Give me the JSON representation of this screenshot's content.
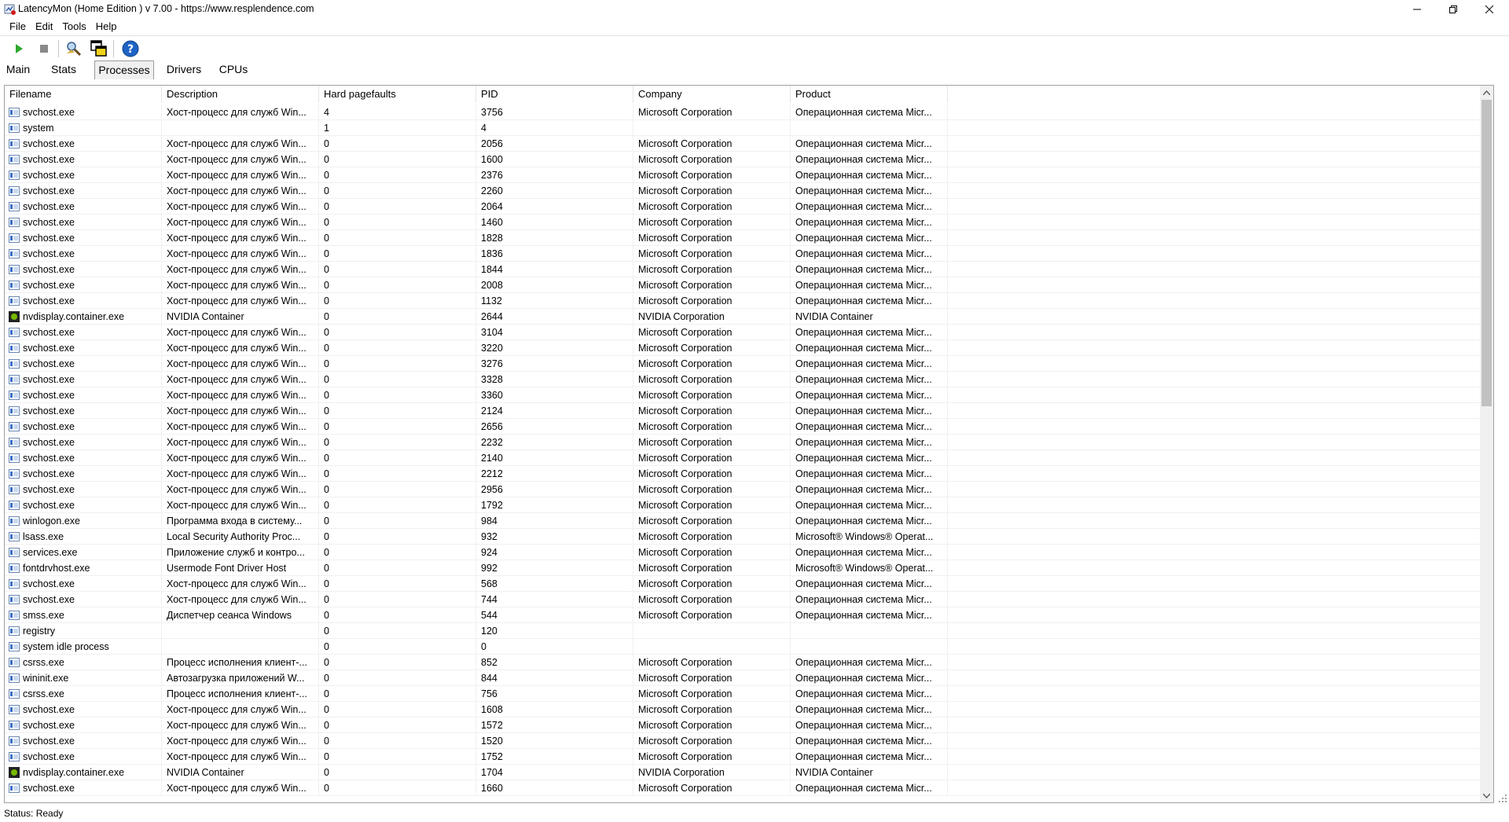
{
  "window": {
    "title": "LatencyMon  (Home Edition )  v 7.00 - https://www.resplendence.com",
    "icon": "latencymon-app-icon"
  },
  "menu": [
    "File",
    "Edit",
    "Tools",
    "Help"
  ],
  "toolbar": {
    "icons": [
      "play-icon",
      "stop-icon",
      "search-icon",
      "windows-icon",
      "help-icon"
    ]
  },
  "tabs": [
    {
      "label": "Main",
      "active": false
    },
    {
      "label": "Stats",
      "active": false
    },
    {
      "label": "Processes",
      "active": true
    },
    {
      "label": "Drivers",
      "active": false
    },
    {
      "label": "CPUs",
      "active": false
    }
  ],
  "table": {
    "columns": [
      "Filename",
      "Description",
      "Hard pagefaults",
      "PID",
      "Company",
      "Product"
    ],
    "rows": [
      {
        "icon": "process",
        "filename": "svchost.exe",
        "description": "Хост-процесс для служб Win...",
        "hard": "4",
        "pid": "3756",
        "company": "Microsoft Corporation",
        "product": "Операционная система Micr..."
      },
      {
        "icon": "process",
        "filename": "system",
        "description": "",
        "hard": "1",
        "pid": "4",
        "company": "",
        "product": ""
      },
      {
        "icon": "process",
        "filename": "svchost.exe",
        "description": "Хост-процесс для служб Win...",
        "hard": "0",
        "pid": "2056",
        "company": "Microsoft Corporation",
        "product": "Операционная система Micr..."
      },
      {
        "icon": "process",
        "filename": "svchost.exe",
        "description": "Хост-процесс для служб Win...",
        "hard": "0",
        "pid": "1600",
        "company": "Microsoft Corporation",
        "product": "Операционная система Micr..."
      },
      {
        "icon": "process",
        "filename": "svchost.exe",
        "description": "Хост-процесс для служб Win...",
        "hard": "0",
        "pid": "2376",
        "company": "Microsoft Corporation",
        "product": "Операционная система Micr..."
      },
      {
        "icon": "process",
        "filename": "svchost.exe",
        "description": "Хост-процесс для служб Win...",
        "hard": "0",
        "pid": "2260",
        "company": "Microsoft Corporation",
        "product": "Операционная система Micr..."
      },
      {
        "icon": "process",
        "filename": "svchost.exe",
        "description": "Хост-процесс для служб Win...",
        "hard": "0",
        "pid": "2064",
        "company": "Microsoft Corporation",
        "product": "Операционная система Micr..."
      },
      {
        "icon": "process",
        "filename": "svchost.exe",
        "description": "Хост-процесс для служб Win...",
        "hard": "0",
        "pid": "1460",
        "company": "Microsoft Corporation",
        "product": "Операционная система Micr..."
      },
      {
        "icon": "process",
        "filename": "svchost.exe",
        "description": "Хост-процесс для служб Win...",
        "hard": "0",
        "pid": "1828",
        "company": "Microsoft Corporation",
        "product": "Операционная система Micr..."
      },
      {
        "icon": "process",
        "filename": "svchost.exe",
        "description": "Хост-процесс для служб Win...",
        "hard": "0",
        "pid": "1836",
        "company": "Microsoft Corporation",
        "product": "Операционная система Micr..."
      },
      {
        "icon": "process",
        "filename": "svchost.exe",
        "description": "Хост-процесс для служб Win...",
        "hard": "0",
        "pid": "1844",
        "company": "Microsoft Corporation",
        "product": "Операционная система Micr..."
      },
      {
        "icon": "process",
        "filename": "svchost.exe",
        "description": "Хост-процесс для служб Win...",
        "hard": "0",
        "pid": "2008",
        "company": "Microsoft Corporation",
        "product": "Операционная система Micr..."
      },
      {
        "icon": "process",
        "filename": "svchost.exe",
        "description": "Хост-процесс для служб Win...",
        "hard": "0",
        "pid": "1132",
        "company": "Microsoft Corporation",
        "product": "Операционная система Micr..."
      },
      {
        "icon": "nvidia",
        "filename": "nvdisplay.container.exe",
        "description": "NVIDIA Container",
        "hard": "0",
        "pid": "2644",
        "company": "NVIDIA Corporation",
        "product": "NVIDIA Container"
      },
      {
        "icon": "process",
        "filename": "svchost.exe",
        "description": "Хост-процесс для служб Win...",
        "hard": "0",
        "pid": "3104",
        "company": "Microsoft Corporation",
        "product": "Операционная система Micr..."
      },
      {
        "icon": "process",
        "filename": "svchost.exe",
        "description": "Хост-процесс для служб Win...",
        "hard": "0",
        "pid": "3220",
        "company": "Microsoft Corporation",
        "product": "Операционная система Micr..."
      },
      {
        "icon": "process",
        "filename": "svchost.exe",
        "description": "Хост-процесс для служб Win...",
        "hard": "0",
        "pid": "3276",
        "company": "Microsoft Corporation",
        "product": "Операционная система Micr..."
      },
      {
        "icon": "process",
        "filename": "svchost.exe",
        "description": "Хост-процесс для служб Win...",
        "hard": "0",
        "pid": "3328",
        "company": "Microsoft Corporation",
        "product": "Операционная система Micr..."
      },
      {
        "icon": "process",
        "filename": "svchost.exe",
        "description": "Хост-процесс для служб Win...",
        "hard": "0",
        "pid": "3360",
        "company": "Microsoft Corporation",
        "product": "Операционная система Micr..."
      },
      {
        "icon": "process",
        "filename": "svchost.exe",
        "description": "Хост-процесс для служб Win...",
        "hard": "0",
        "pid": "2124",
        "company": "Microsoft Corporation",
        "product": "Операционная система Micr..."
      },
      {
        "icon": "process",
        "filename": "svchost.exe",
        "description": "Хост-процесс для служб Win...",
        "hard": "0",
        "pid": "2656",
        "company": "Microsoft Corporation",
        "product": "Операционная система Micr..."
      },
      {
        "icon": "process",
        "filename": "svchost.exe",
        "description": "Хост-процесс для служб Win...",
        "hard": "0",
        "pid": "2232",
        "company": "Microsoft Corporation",
        "product": "Операционная система Micr..."
      },
      {
        "icon": "process",
        "filename": "svchost.exe",
        "description": "Хост-процесс для служб Win...",
        "hard": "0",
        "pid": "2140",
        "company": "Microsoft Corporation",
        "product": "Операционная система Micr..."
      },
      {
        "icon": "process",
        "filename": "svchost.exe",
        "description": "Хост-процесс для служб Win...",
        "hard": "0",
        "pid": "2212",
        "company": "Microsoft Corporation",
        "product": "Операционная система Micr..."
      },
      {
        "icon": "process",
        "filename": "svchost.exe",
        "description": "Хост-процесс для служб Win...",
        "hard": "0",
        "pid": "2956",
        "company": "Microsoft Corporation",
        "product": "Операционная система Micr..."
      },
      {
        "icon": "process",
        "filename": "svchost.exe",
        "description": "Хост-процесс для служб Win...",
        "hard": "0",
        "pid": "1792",
        "company": "Microsoft Corporation",
        "product": "Операционная система Micr..."
      },
      {
        "icon": "process",
        "filename": "winlogon.exe",
        "description": "Программа входа в систему...",
        "hard": "0",
        "pid": "984",
        "company": "Microsoft Corporation",
        "product": "Операционная система Micr..."
      },
      {
        "icon": "process",
        "filename": "lsass.exe",
        "description": "Local Security Authority Proc...",
        "hard": "0",
        "pid": "932",
        "company": "Microsoft Corporation",
        "product": "Microsoft® Windows® Operat..."
      },
      {
        "icon": "process",
        "filename": "services.exe",
        "description": "Приложение служб и контро...",
        "hard": "0",
        "pid": "924",
        "company": "Microsoft Corporation",
        "product": "Операционная система Micr..."
      },
      {
        "icon": "process",
        "filename": "fontdrvhost.exe",
        "description": "Usermode Font Driver Host",
        "hard": "0",
        "pid": "992",
        "company": "Microsoft Corporation",
        "product": "Microsoft® Windows® Operat..."
      },
      {
        "icon": "process",
        "filename": "svchost.exe",
        "description": "Хост-процесс для служб Win...",
        "hard": "0",
        "pid": "568",
        "company": "Microsoft Corporation",
        "product": "Операционная система Micr..."
      },
      {
        "icon": "process",
        "filename": "svchost.exe",
        "description": "Хост-процесс для служб Win...",
        "hard": "0",
        "pid": "744",
        "company": "Microsoft Corporation",
        "product": "Операционная система Micr..."
      },
      {
        "icon": "process",
        "filename": "smss.exe",
        "description": "Диспетчер сеанса  Windows",
        "hard": "0",
        "pid": "544",
        "company": "Microsoft Corporation",
        "product": "Операционная система Micr..."
      },
      {
        "icon": "process",
        "filename": "registry",
        "description": "",
        "hard": "0",
        "pid": "120",
        "company": "",
        "product": ""
      },
      {
        "icon": "process",
        "filename": "system idle process",
        "description": "",
        "hard": "0",
        "pid": "0",
        "company": "",
        "product": ""
      },
      {
        "icon": "process",
        "filename": "csrss.exe",
        "description": "Процесс исполнения клиент-...",
        "hard": "0",
        "pid": "852",
        "company": "Microsoft Corporation",
        "product": "Операционная система Micr..."
      },
      {
        "icon": "process",
        "filename": "wininit.exe",
        "description": "Автозагрузка приложений W...",
        "hard": "0",
        "pid": "844",
        "company": "Microsoft Corporation",
        "product": "Операционная система Micr..."
      },
      {
        "icon": "process",
        "filename": "csrss.exe",
        "description": "Процесс исполнения клиент-...",
        "hard": "0",
        "pid": "756",
        "company": "Microsoft Corporation",
        "product": "Операционная система Micr..."
      },
      {
        "icon": "process",
        "filename": "svchost.exe",
        "description": "Хост-процесс для служб Win...",
        "hard": "0",
        "pid": "1608",
        "company": "Microsoft Corporation",
        "product": "Операционная система Micr..."
      },
      {
        "icon": "process",
        "filename": "svchost.exe",
        "description": "Хост-процесс для служб Win...",
        "hard": "0",
        "pid": "1572",
        "company": "Microsoft Corporation",
        "product": "Операционная система Micr..."
      },
      {
        "icon": "process",
        "filename": "svchost.exe",
        "description": "Хост-процесс для служб Win...",
        "hard": "0",
        "pid": "1520",
        "company": "Microsoft Corporation",
        "product": "Операционная система Micr..."
      },
      {
        "icon": "process",
        "filename": "svchost.exe",
        "description": "Хост-процесс для служб Win...",
        "hard": "0",
        "pid": "1752",
        "company": "Microsoft Corporation",
        "product": "Операционная система Micr..."
      },
      {
        "icon": "nvidia",
        "filename": "nvdisplay.container.exe",
        "description": "NVIDIA Container",
        "hard": "0",
        "pid": "1704",
        "company": "NVIDIA Corporation",
        "product": "NVIDIA Container"
      },
      {
        "icon": "process",
        "filename": "svchost.exe",
        "description": "Хост-процесс для служб Win...",
        "hard": "0",
        "pid": "1660",
        "company": "Microsoft Corporation",
        "product": "Операционная система Micr..."
      }
    ]
  },
  "status": {
    "text": "Status: Ready"
  },
  "colors": {
    "play_green": "#2fa82f",
    "help_blue": "#1e63c4",
    "nvidia_green": "#76b900"
  }
}
